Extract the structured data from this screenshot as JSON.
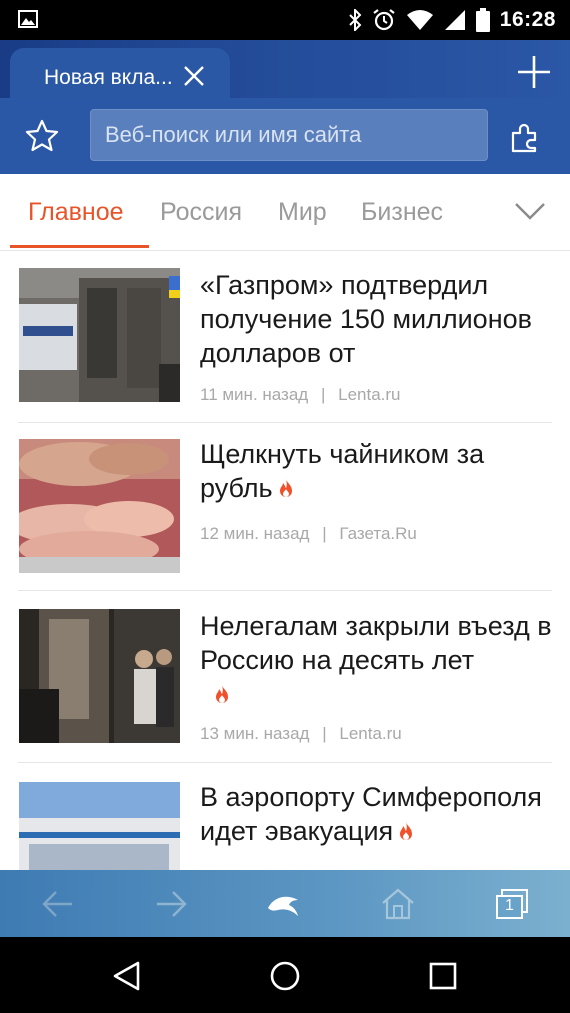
{
  "status_bar": {
    "time": "16:28"
  },
  "tab": {
    "title": "Новая вкла..."
  },
  "search": {
    "placeholder": "Веб-поиск или имя сайта"
  },
  "categories": [
    {
      "label": "Главное",
      "active": true
    },
    {
      "label": "Россия"
    },
    {
      "label": "Мир"
    },
    {
      "label": "Бизнес"
    }
  ],
  "news": [
    {
      "title": "«Газпром» подтвердил получение 150 миллионов долларов от",
      "time": "11 мин. назад",
      "source": "Lenta.ru",
      "hot": false
    },
    {
      "title": "Щелкнуть чайником за рубль",
      "time": "12 мин. назад",
      "source": "Газета.Ru",
      "hot": true
    },
    {
      "title": "Нелегалам закрыли въезд в Россию на десять лет",
      "time": "13 мин. назад",
      "source": "Lenta.ru",
      "hot": true
    },
    {
      "title": "В аэропорту Симферополя идет эвакуация",
      "hot": true
    }
  ],
  "bottom_bar": {
    "tab_count": "1"
  },
  "colors": {
    "accent": "#e8542a",
    "header": "#2a57a6",
    "bottom_bar": "#5d97c3"
  }
}
